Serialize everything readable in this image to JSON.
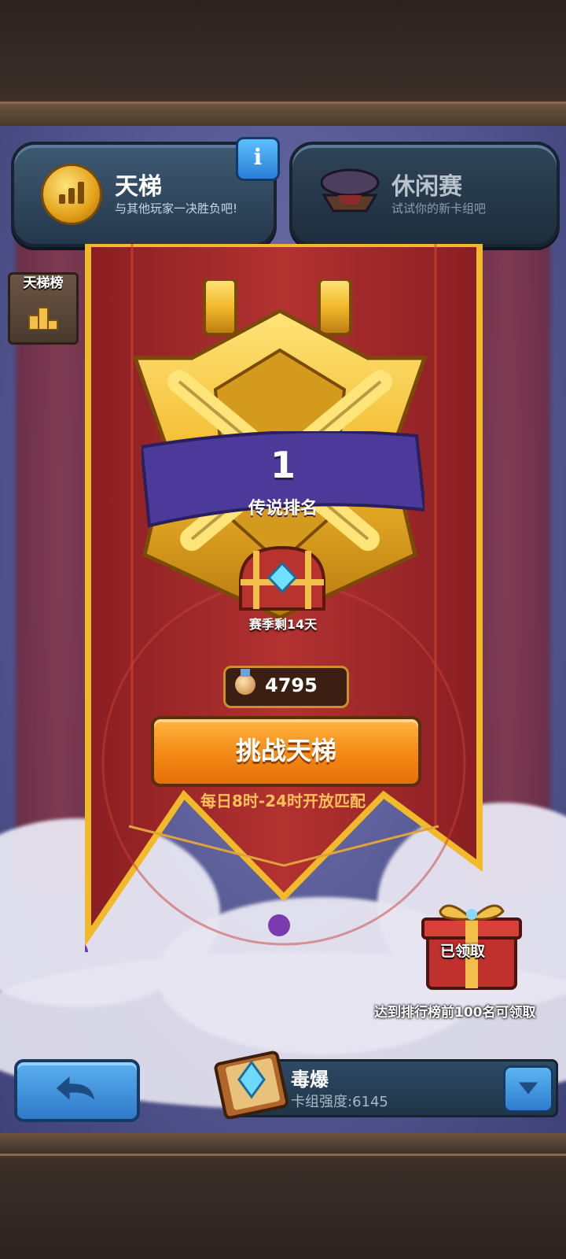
{
  "tabs": {
    "ladder": {
      "title": "天梯",
      "subtitle": "与其他玩家一决胜负吧!",
      "info_icon": "i"
    },
    "casual": {
      "title": "休闲赛",
      "subtitle": "试试你的新卡组吧"
    }
  },
  "leaderboard_button": {
    "label": "天梯榜"
  },
  "rank": {
    "value": "1",
    "label": "传说排名"
  },
  "season": {
    "remaining": "赛季剩14天"
  },
  "trophies": {
    "value": "4795"
  },
  "challenge_button": {
    "label": "挑战天梯"
  },
  "open_hours": "每日8时-24时开放匹配",
  "reward": {
    "status": "已领取",
    "hint": "达到排行榜前100名可领取"
  },
  "deck": {
    "name": "毒爆",
    "power": "卡组强度:6145"
  },
  "colors": {
    "banner_red": "#a52a2a",
    "gold": "#f2b92a",
    "accent_orange": "#f38914",
    "ribbon_purple": "#4b3a9a"
  }
}
